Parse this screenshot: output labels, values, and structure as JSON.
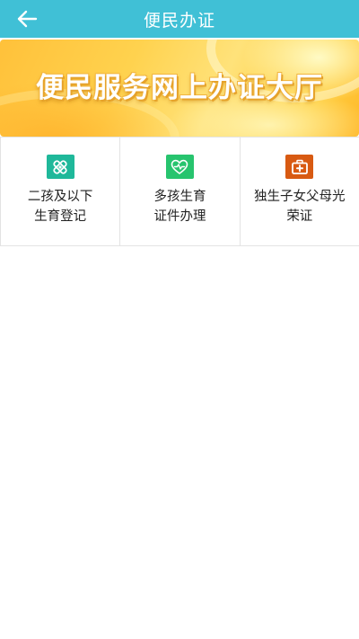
{
  "header": {
    "title": "便民办证",
    "background": "#40c0d6",
    "back_icon": "arrow-left-icon"
  },
  "banner": {
    "text": "便民服务网上办证大厅"
  },
  "services": [
    {
      "line1": "二孩及以下",
      "line2": "生育登记",
      "icon": "medicine-box-icon",
      "icon_color": "#1fb89a"
    },
    {
      "line1": "多孩生育",
      "line2": "证件办理",
      "icon": "heart-pulse-icon",
      "icon_color": "#27c46e"
    },
    {
      "line1": "独生子女父母光",
      "line2": "荣证",
      "icon": "medical-kit-icon",
      "icon_color": "#d85a12"
    }
  ]
}
